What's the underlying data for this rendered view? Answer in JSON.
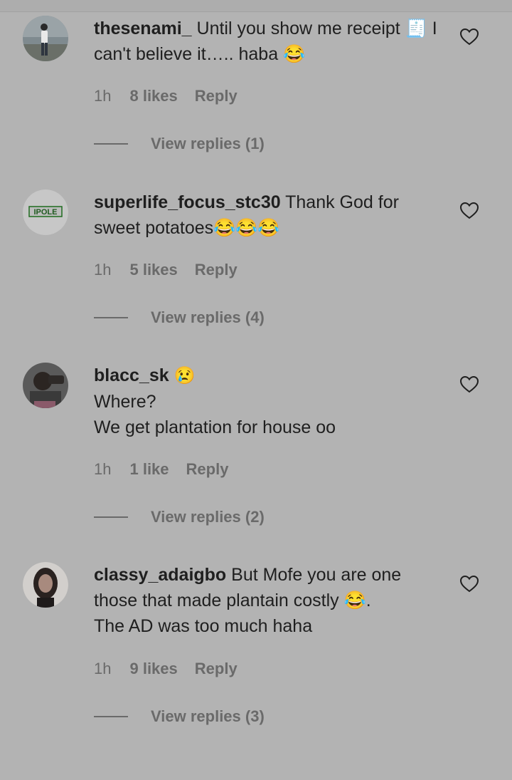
{
  "comments": [
    {
      "username": "thesenami_",
      "text": "Until you show me receipt 🧾 I can't believe it….. haba 😂",
      "time": "1h",
      "likes": "8 likes",
      "reply": "Reply",
      "view_replies": "View replies (1)",
      "avatar": "person-standing-icon"
    },
    {
      "username": "superlife_focus_stc30",
      "text": "Thank God for sweet potatoes😂😂😂",
      "time": "1h",
      "likes": "5 likes",
      "reply": "Reply",
      "view_replies": "View replies (4)",
      "avatar_text": "IPOLE"
    },
    {
      "username": "blacc_sk",
      "text_line1": "😢",
      "text_line2": "Where?",
      "text_line3": "We get plantation for house oo",
      "time": "1h",
      "likes": "1 like",
      "reply": "Reply",
      "view_replies": "View replies (2)",
      "avatar": "person-portrait-icon"
    },
    {
      "username": "classy_adaigbo",
      "text": "But Mofe you are one those that made plantain costly 😂.",
      "text_line2": "The AD was too much haha",
      "time": "1h",
      "likes": "9 likes",
      "reply": "Reply",
      "view_replies": "View replies (3)",
      "avatar": "person-portrait-icon"
    }
  ],
  "colors": {
    "background": "#b3b3b3",
    "primary_text": "#1f1f1f",
    "secondary_text": "#6a6a6a"
  }
}
